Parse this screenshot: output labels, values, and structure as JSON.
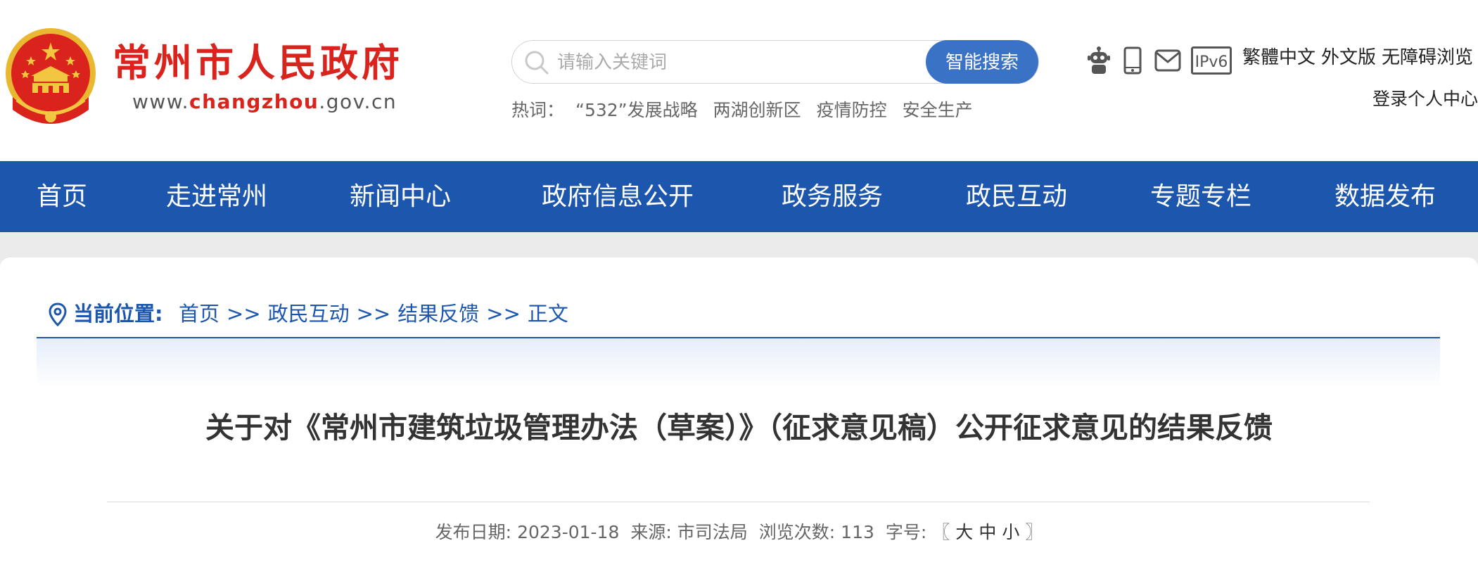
{
  "header": {
    "site_name": "常州市人民政府",
    "url_prefix": "www.",
    "url_highlight": "changzhou",
    "url_suffix": ".gov.cn",
    "search": {
      "placeholder": "请输入关键词",
      "button_label": "智能搜索"
    },
    "hotwords": {
      "label": "热词：",
      "items": [
        "“532”发展战略",
        "两湖创新区",
        "疫情防控",
        "安全生产"
      ]
    },
    "utility": {
      "icons": [
        "robot-icon",
        "mobile-icon",
        "mail-icon",
        "ipv6-icon"
      ],
      "ipv6_text": "IPv6",
      "links": [
        "繁體中文",
        "外文版",
        "无障碍浏览"
      ],
      "login": "登录",
      "personal_center": "个人中心"
    }
  },
  "nav": {
    "items": [
      "首页",
      "走进常州",
      "新闻中心",
      "政府信息公开",
      "政务服务",
      "政民互动",
      "专题专栏",
      "数据发布"
    ]
  },
  "breadcrumb": {
    "label": "当前位置:",
    "items": [
      "首页",
      "政民互动",
      "结果反馈",
      "正文"
    ],
    "separator": ">>"
  },
  "article": {
    "title": "关于对《常州市建筑垃圾管理办法（草案）》（征求意见稿）公开征求意见的结果反馈",
    "meta": {
      "date_label": "发布日期:",
      "date": "2023-01-18",
      "source_label": "来源:",
      "source": "市司法局",
      "views_label": "浏览次数:",
      "views": "113",
      "fontsize_label": "字号:",
      "bracket_open": "〖",
      "size_large": "大",
      "size_medium": "中",
      "size_small": "小",
      "bracket_close": "〗"
    }
  },
  "colors": {
    "brand_red": "#d9231c",
    "nav_blue": "#1c56ad",
    "search_button": "#3a72c6",
    "page_gray": "#ebebeb"
  }
}
